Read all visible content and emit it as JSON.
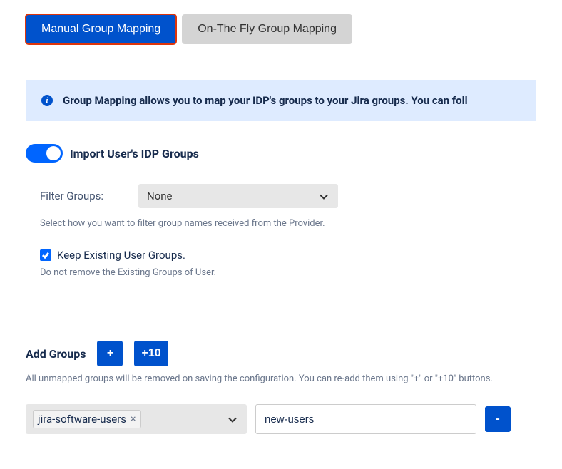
{
  "tabs": {
    "manual": "Manual Group Mapping",
    "onthefly": "On-The Fly Group Mapping"
  },
  "banner": {
    "text": "Group Mapping allows you to map your IDP's groups to your Jira groups. You can foll"
  },
  "toggle": {
    "label": "Import User's IDP Groups"
  },
  "filter": {
    "label": "Filter Groups:",
    "value": "None",
    "hint": "Select how you want to filter group names received from the Provider."
  },
  "keep": {
    "label": "Keep Existing User Groups.",
    "hint": "Do not remove the Existing Groups of User."
  },
  "addGroups": {
    "label": "Add Groups",
    "plus": "+",
    "plusTen": "+10",
    "hint": "All unmapped groups will be removed on saving the configuration. You can re-add them using \"+\" or \"+10\" buttons."
  },
  "mapping": {
    "sourceGroup": "jira-software-users",
    "target": "new-users",
    "removeLabel": "-"
  }
}
